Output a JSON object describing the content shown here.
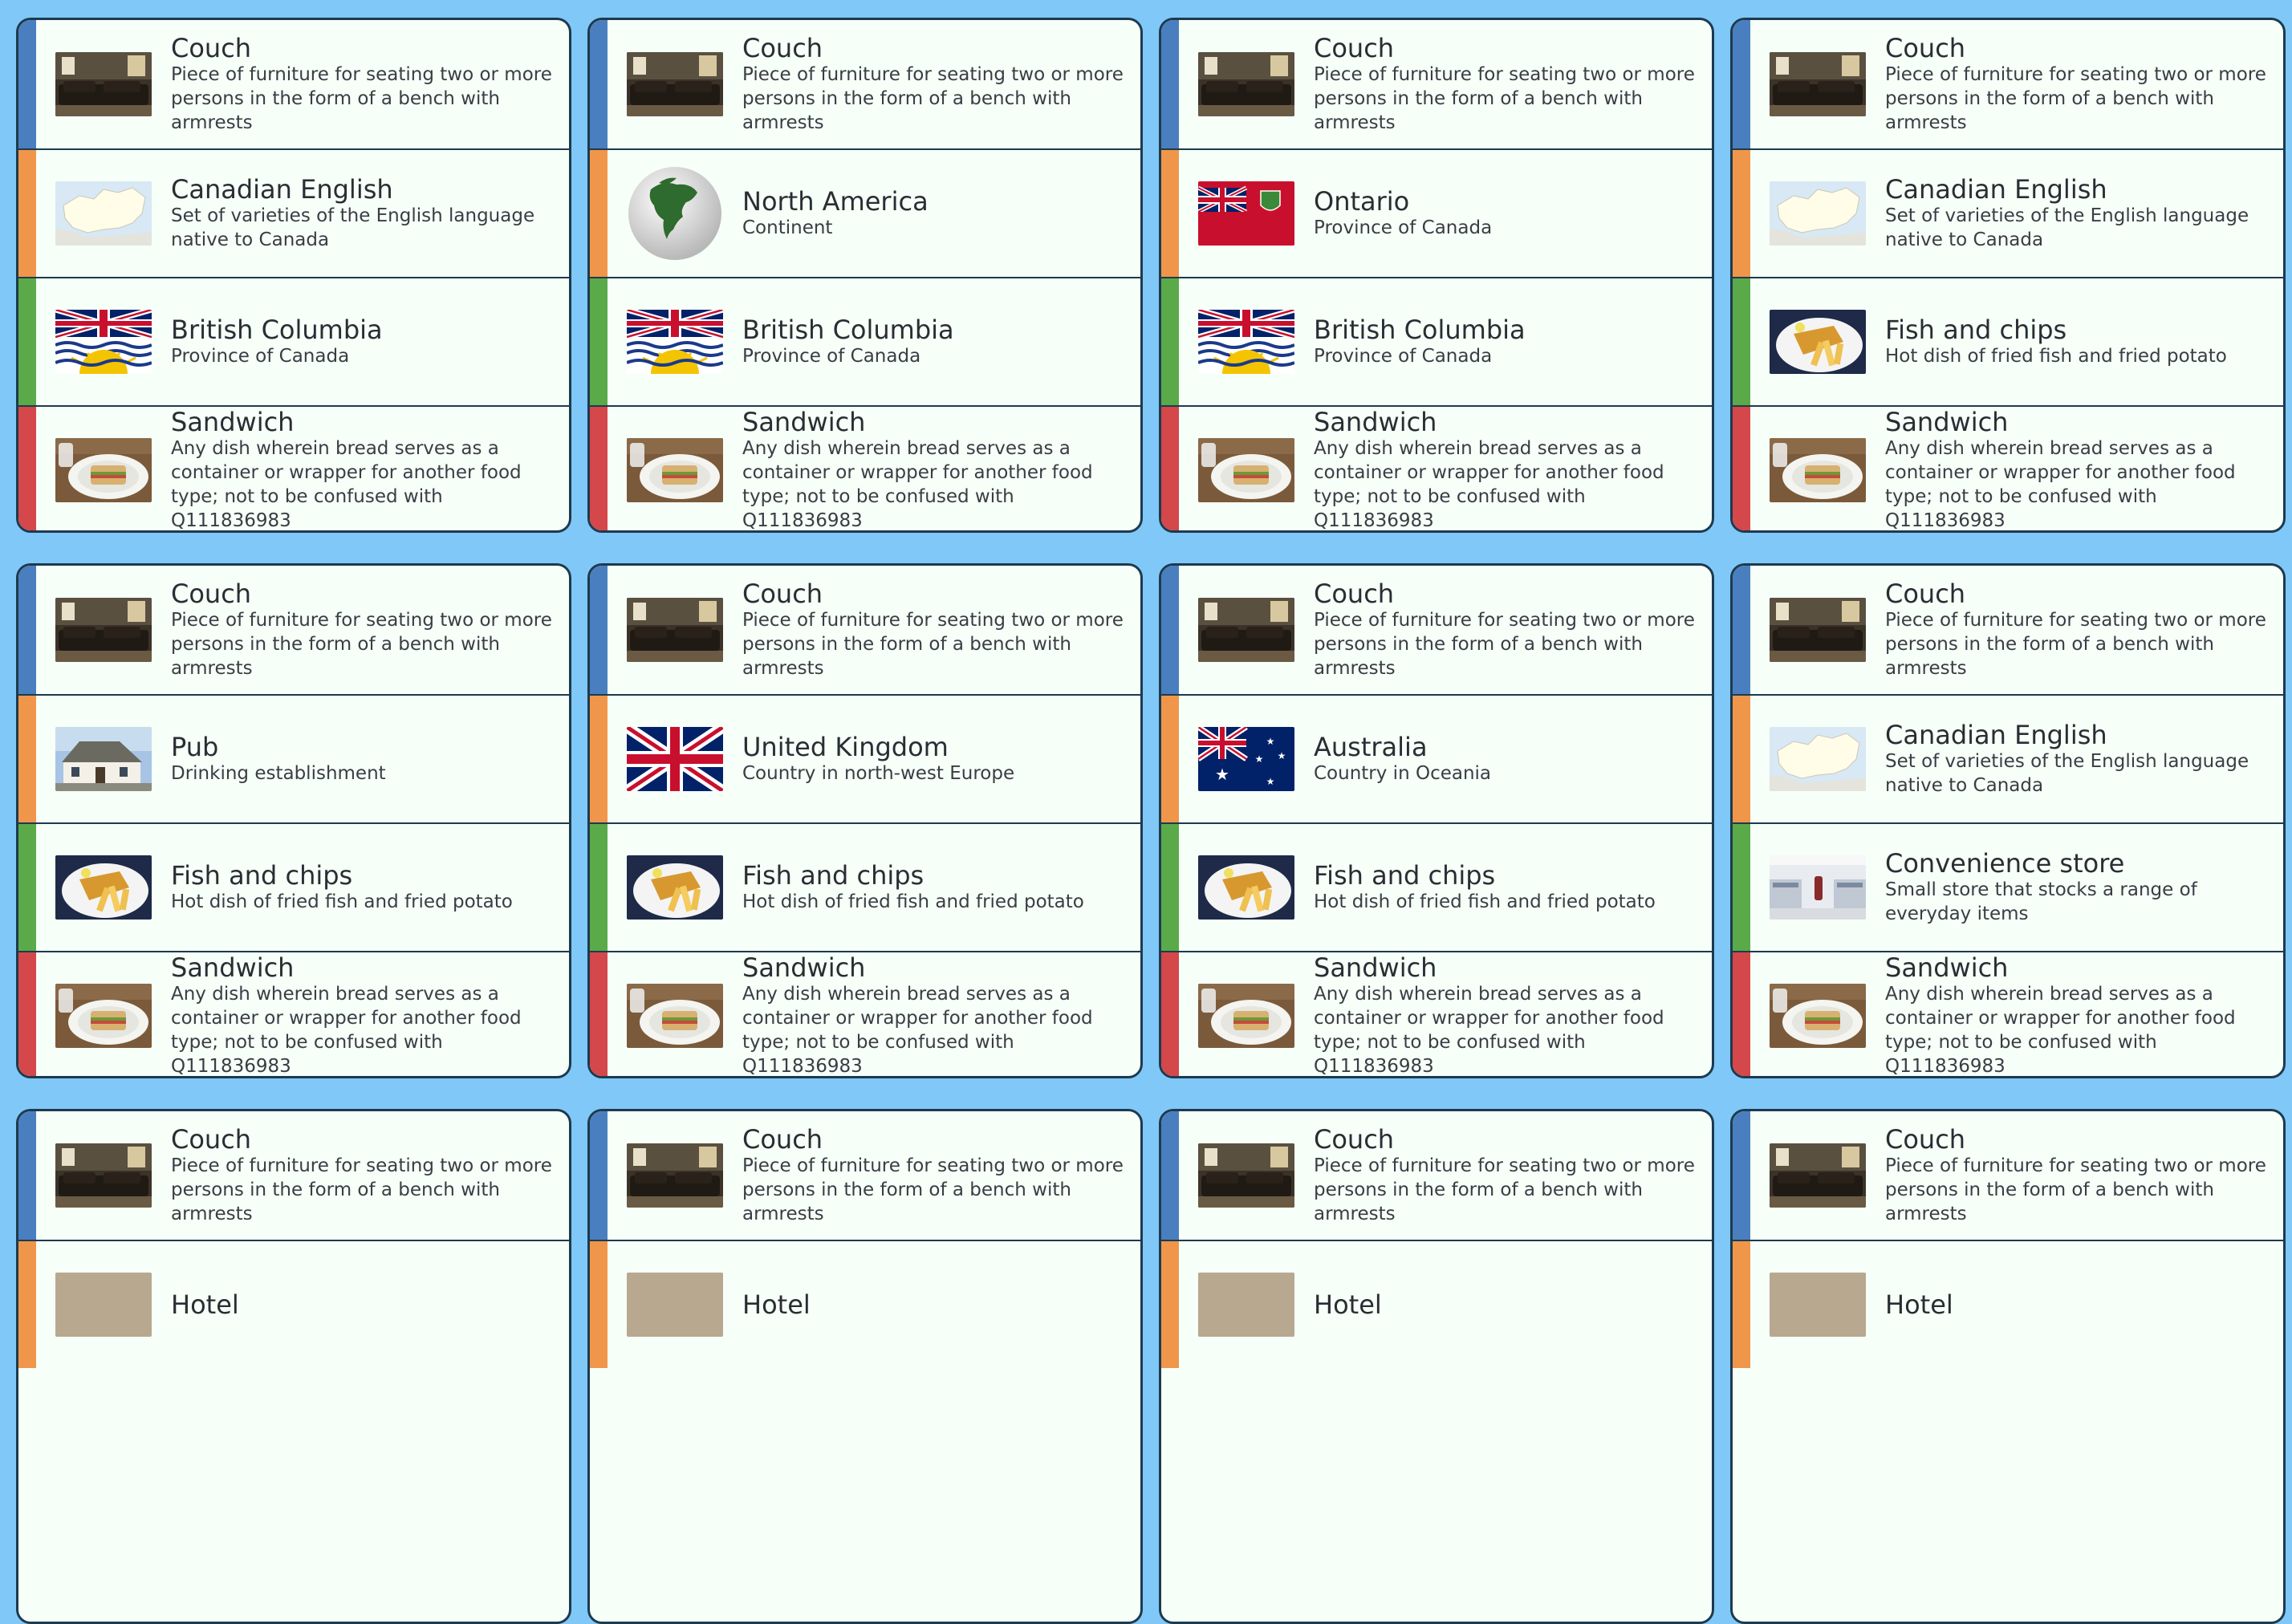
{
  "colors": {
    "background": "#80c8f8",
    "card_bg": "#f6fff8",
    "border": "#1d3a4e",
    "stripes": [
      "#4a7fbf",
      "#f0964a",
      "#5aaa4a",
      "#d4474a"
    ]
  },
  "items": {
    "couch": {
      "title": "Couch",
      "desc": "Piece of furniture for seating two or more persons in the form of a bench with armrests",
      "icon": "couch-photo-icon"
    },
    "canadian_english": {
      "title": "Canadian English",
      "desc": "Set of varieties of the English language native to Canada",
      "icon": "canada-map-icon"
    },
    "british_columbia": {
      "title": "British Columbia",
      "desc": "Province of Canada",
      "icon": "british-columbia-flag-icon"
    },
    "sandwich": {
      "title": "Sandwich",
      "desc": "Any dish wherein bread serves as a container or wrapper for another food type; not to be confused with Q111836983",
      "icon": "sandwich-photo-icon"
    },
    "north_america": {
      "title": "North America",
      "desc": "Continent",
      "icon": "globe-icon"
    },
    "ontario": {
      "title": "Ontario",
      "desc": "Province of Canada",
      "icon": "ontario-flag-icon"
    },
    "fish_and_chips": {
      "title": "Fish and chips",
      "desc": "Hot dish of fried fish and fried potato",
      "icon": "fish-and-chips-photo-icon"
    },
    "pub": {
      "title": "Pub",
      "desc": "Drinking establishment",
      "icon": "pub-photo-icon"
    },
    "united_kingdom": {
      "title": "United Kingdom",
      "desc": "Country in north-west Europe",
      "icon": "union-jack-flag-icon"
    },
    "australia": {
      "title": "Australia",
      "desc": "Country in Oceania",
      "icon": "australia-flag-icon"
    },
    "convenience_store": {
      "title": "Convenience store",
      "desc": "Small store that stocks a range of everyday items",
      "icon": "store-photo-icon"
    },
    "hotel_partial": {
      "title": "Hotel",
      "desc": "",
      "icon": "hotel-photo-icon"
    }
  },
  "cards": [
    [
      "couch",
      "canadian_english",
      "british_columbia",
      "sandwich"
    ],
    [
      "couch",
      "north_america",
      "british_columbia",
      "sandwich"
    ],
    [
      "couch",
      "ontario",
      "british_columbia",
      "sandwich"
    ],
    [
      "couch",
      "canadian_english",
      "fish_and_chips",
      "sandwich"
    ],
    [
      "couch",
      "pub",
      "fish_and_chips",
      "sandwich"
    ],
    [
      "couch",
      "united_kingdom",
      "fish_and_chips",
      "sandwich"
    ],
    [
      "couch",
      "australia",
      "fish_and_chips",
      "sandwich"
    ],
    [
      "couch",
      "canadian_english",
      "convenience_store",
      "sandwich"
    ],
    [
      "couch",
      "hotel_partial"
    ],
    [
      "couch",
      "hotel_partial"
    ],
    [
      "couch",
      "hotel_partial"
    ],
    [
      "couch",
      "hotel_partial"
    ]
  ]
}
